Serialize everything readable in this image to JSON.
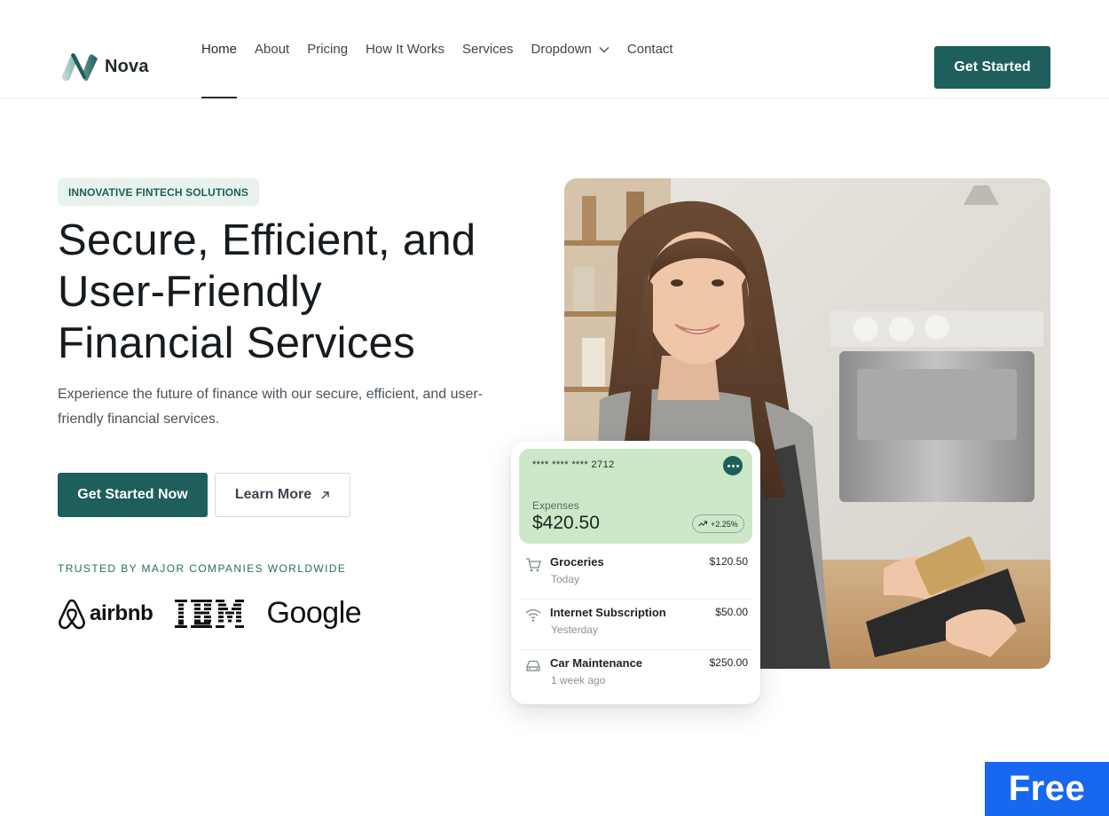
{
  "brand": {
    "name": "Nova"
  },
  "nav": {
    "items": [
      {
        "label": "Home",
        "active": true
      },
      {
        "label": "About"
      },
      {
        "label": "Pricing"
      },
      {
        "label": "How It Works"
      },
      {
        "label": "Services"
      },
      {
        "label": "Dropdown",
        "icon": "chevron-down-icon"
      },
      {
        "label": "Contact"
      }
    ],
    "cta_label": "Get Started"
  },
  "hero": {
    "badge": "INNOVATIVE FINTECH SOLUTIONS",
    "title_lines": [
      "Secure, Efficient, and",
      "User-Friendly",
      "Financial Services"
    ],
    "subtitle": "Experience the future of finance with our secure, efficient, and user-friendly financial services.",
    "primary_cta": "Get Started Now",
    "secondary_cta": "Learn More",
    "secondary_cta_icon": "arrow-up-right-icon",
    "trusted_label": "TRUSTED BY MAJOR COMPANIES WORLDWIDE",
    "companies": [
      "airbnb",
      "IBM",
      "Google"
    ]
  },
  "card": {
    "number": "**** **** ****  2712",
    "expenses_label": "Expenses",
    "expenses_amount": "$420.50",
    "change": "+2.25%",
    "transactions": [
      {
        "name": "Groceries",
        "time": "Today",
        "amount": "$120.50",
        "icon": "cart-icon"
      },
      {
        "name": "Internet Subscription",
        "time": "Yesterday",
        "amount": "$50.00",
        "icon": "wifi-icon"
      },
      {
        "name": "Car Maintenance",
        "time": "1 week ago",
        "amount": "$250.00",
        "icon": "car-icon"
      }
    ]
  },
  "tag": {
    "label": "Free"
  },
  "colors": {
    "primary": "#1e5e5b",
    "badge_bg": "#e9f3ee",
    "card_green": "#cde7c9",
    "tag_blue": "#1767f0"
  }
}
